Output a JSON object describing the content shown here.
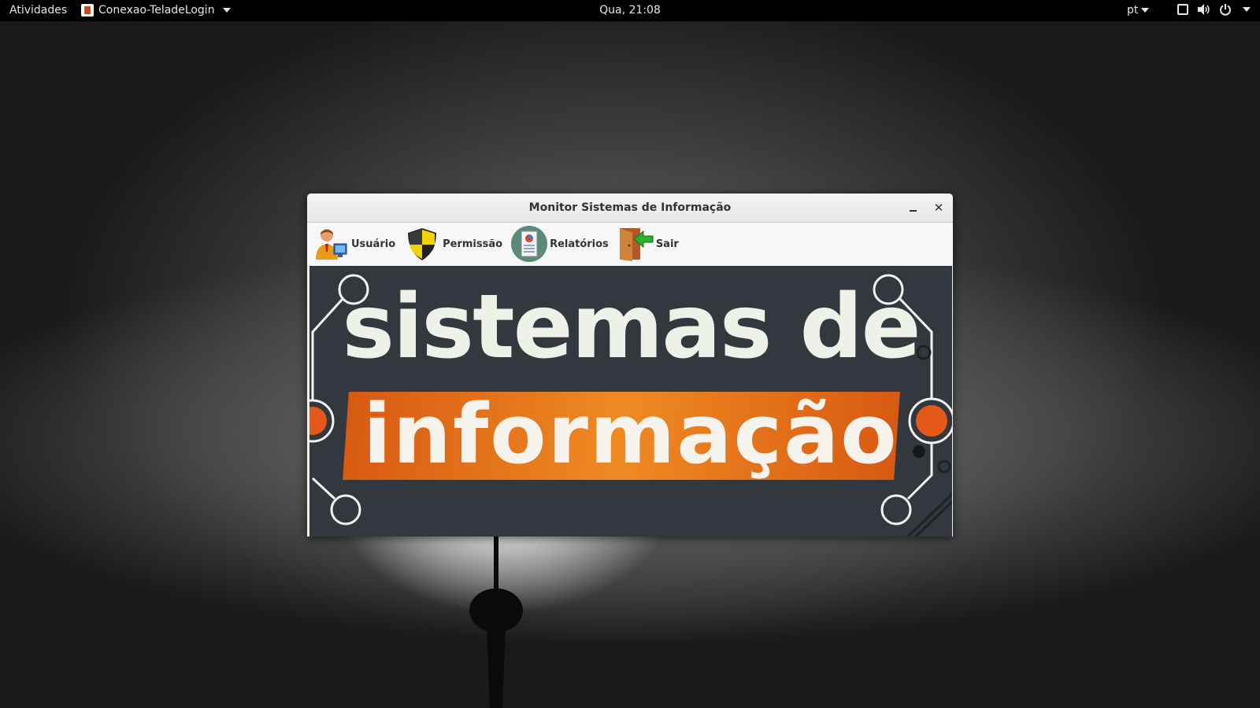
{
  "topbar": {
    "activities": "Atividades",
    "app_name": "Conexao-TeladeLogin",
    "clock": "Qua, 21:08",
    "language": "pt"
  },
  "window": {
    "title": "Monitor Sistemas de Informação",
    "toolbar": [
      {
        "label": "Usuário",
        "icon": "user-icon"
      },
      {
        "label": "Permissão",
        "icon": "shield-icon"
      },
      {
        "label": "Relatórios",
        "icon": "report-icon"
      },
      {
        "label": "Sair",
        "icon": "exit-door-icon"
      }
    ],
    "banner": {
      "line1": "sistemas de",
      "line2": "informação"
    }
  },
  "colors": {
    "topbar": "#000000",
    "banner_bg": "#33373e",
    "banner_accent": "#e4701a",
    "banner_text": "#eef1e8"
  }
}
